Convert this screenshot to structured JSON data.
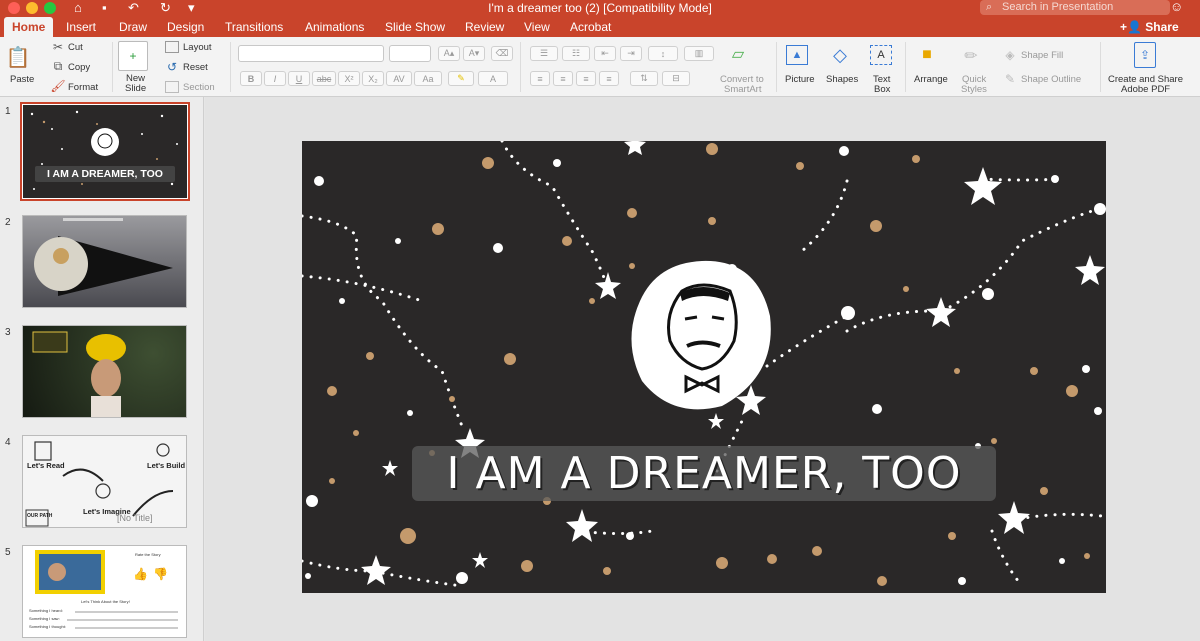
{
  "window": {
    "title": "I'm a dreamer too (2) [Compatibility Mode]",
    "search_placeholder": "Search in Presentation",
    "share_label": "Share"
  },
  "quick_access": {
    "home": "⌂",
    "save": "▪",
    "undo": "↶",
    "redo": "↻",
    "more": "▾"
  },
  "tabs": [
    {
      "label": "Home",
      "active": true
    },
    {
      "label": "Insert"
    },
    {
      "label": "Draw"
    },
    {
      "label": "Design"
    },
    {
      "label": "Transitions"
    },
    {
      "label": "Animations"
    },
    {
      "label": "Slide Show"
    },
    {
      "label": "Review"
    },
    {
      "label": "View"
    },
    {
      "label": "Acrobat"
    }
  ],
  "ribbon": {
    "clipboard": {
      "paste": "Paste",
      "cut": "Cut",
      "copy": "Copy",
      "format": "Format"
    },
    "slides": {
      "new_slide_line1": "New",
      "new_slide_line2": "Slide",
      "layout": "Layout",
      "reset": "Reset",
      "section": "Section"
    },
    "font": {
      "bold": "B",
      "italic": "I",
      "underline": "U",
      "strike": "abc",
      "superscript": "X²",
      "subscript": "X₂"
    },
    "smartart": {
      "line1": "Convert to",
      "line2": "SmartArt"
    },
    "insert": {
      "picture": "Picture",
      "shapes": "Shapes",
      "textbox_line1": "Text",
      "textbox_line2": "Box"
    },
    "drawing": {
      "arrange": "Arrange",
      "quick_styles_line1": "Quick",
      "quick_styles_line2": "Styles",
      "shape_fill": "Shape Fill",
      "shape_outline": "Shape Outline"
    },
    "acrobat": {
      "line1": "Create and Share",
      "line2": "Adobe PDF"
    }
  },
  "thumbnails": [
    {
      "number": "1",
      "caption": "I AM A DREAMER, TOO",
      "selected": true
    },
    {
      "number": "2",
      "caption": ""
    },
    {
      "number": "3",
      "caption": ""
    },
    {
      "number": "4",
      "caption": "[No Title]",
      "labels": [
        "Let's Read",
        "Let's Build",
        "Let's Imagine",
        "OUR PATH"
      ]
    },
    {
      "number": "5",
      "caption": "",
      "labels": [
        "Rate the Story",
        "Let's Think About the Story!",
        "Something I heard:",
        "Something I saw:",
        "Something I thought:"
      ]
    }
  ],
  "slide": {
    "title": "I AM A DREAMER, TOO"
  },
  "colors": {
    "accent": "#c9442b",
    "slide_bg": "#2a2828",
    "dot_tan": "#c49a6c"
  }
}
